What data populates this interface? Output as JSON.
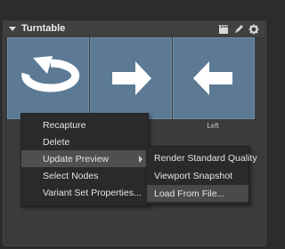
{
  "panel": {
    "title": "Turntable",
    "header_icons": [
      "clapperboard-icon",
      "pencil-icon",
      "gear-icon"
    ]
  },
  "tiles": [
    {
      "icon": "rotate-arrow-icon",
      "caption": ""
    },
    {
      "icon": "arrow-right-icon",
      "caption": ""
    },
    {
      "icon": "arrow-left-icon",
      "caption": "Left"
    }
  ],
  "context_menu": {
    "items": [
      "Recapture",
      "Delete",
      "Update Preview",
      "Select Nodes",
      "Variant Set Properties..."
    ],
    "highlighted": "Update Preview"
  },
  "submenu": {
    "items": [
      "Render Standard Quality",
      "Viewport Snapshot",
      "Load From File..."
    ],
    "highlighted": "Load From File..."
  },
  "colors": {
    "tile_fill": "#5c7a94",
    "menu_bg": "#2a2a2a",
    "highlight": "#4f4f4f"
  }
}
